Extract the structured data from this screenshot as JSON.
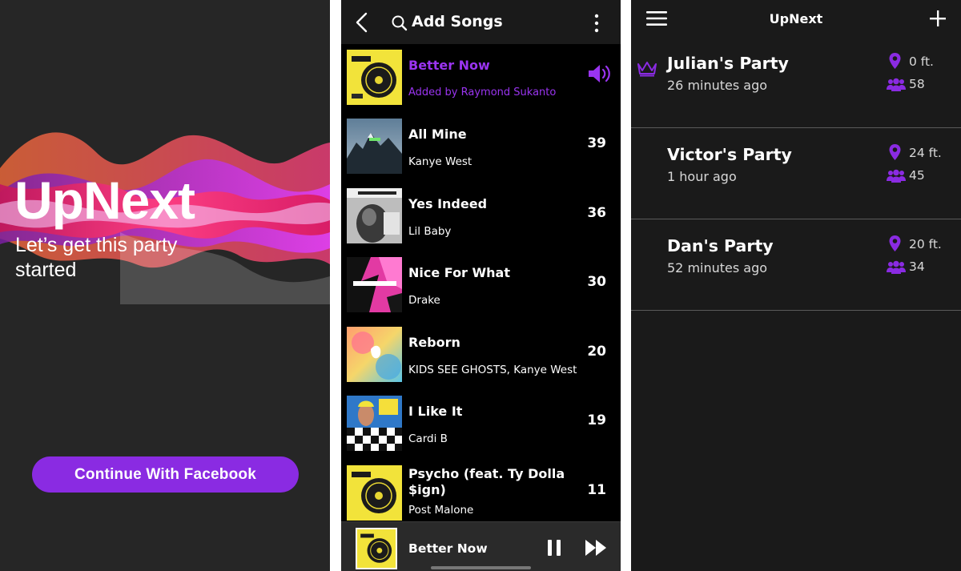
{
  "splash": {
    "brand": "UpNext",
    "tagline": "Let’s get this party started",
    "facebook_button": "Continue With Facebook"
  },
  "add_songs": {
    "title": "Add Songs",
    "now_playing": {
      "title": "Better Now",
      "added_by": "Added by Raymond Sukanto"
    },
    "songs": [
      {
        "title": "All Mine",
        "artist": "Kanye West",
        "votes": "39"
      },
      {
        "title": "Yes Indeed",
        "artist": "Lil Baby",
        "votes": "36"
      },
      {
        "title": "Nice For What",
        "artist": "Drake",
        "votes": "30"
      },
      {
        "title": "Reborn",
        "artist": "KIDS SEE GHOSTS, Kanye West",
        "votes": "20"
      },
      {
        "title": "I Like It",
        "artist": "Cardi B",
        "votes": "19"
      },
      {
        "title": "Psycho (feat. Ty Dolla $ign)",
        "artist": "Post Malone",
        "votes": "11"
      }
    ],
    "player": {
      "title": "Better Now"
    }
  },
  "parties": {
    "app_title": "UpNext",
    "items": [
      {
        "name": "Julian's Party",
        "time": "26 minutes ago",
        "distance": "0 ft.",
        "people": "58",
        "owner": true
      },
      {
        "name": "Victor's Party",
        "time": "1 hour ago",
        "distance": "24 ft.",
        "people": "45",
        "owner": false
      },
      {
        "name": "Dan's Party",
        "time": "52 minutes ago",
        "distance": "20 ft.",
        "people": "34",
        "owner": false
      }
    ]
  },
  "colors": {
    "accent": "#8a2be2",
    "accent_text": "#9a34f0",
    "splash_bg": "#262626",
    "list_bg": "#000000",
    "parties_bg": "#1a1a1a"
  },
  "icons": [
    "wave-graphic",
    "back-icon",
    "search-icon",
    "more-vertical-icon",
    "speaker-icon",
    "pause-icon",
    "fast-forward-icon",
    "menu-icon",
    "plus-icon",
    "crown-icon",
    "location-pin-icon",
    "people-icon"
  ]
}
